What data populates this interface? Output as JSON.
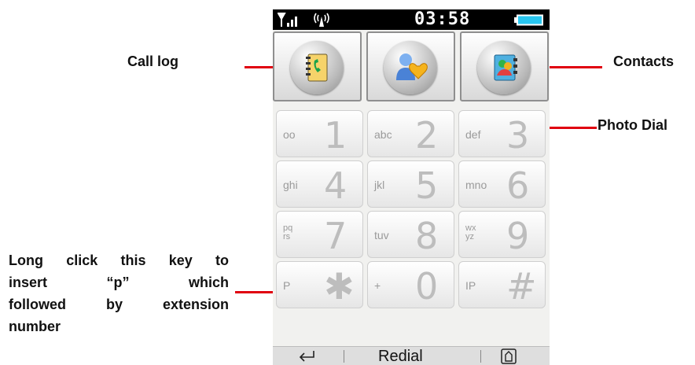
{
  "status": {
    "time": "03:58"
  },
  "top_buttons": [
    {
      "name": "call-log-button",
      "icon": "call-log-icon"
    },
    {
      "name": "photo-dial-button",
      "icon": "photo-dial-icon"
    },
    {
      "name": "contacts-button",
      "icon": "contacts-icon"
    }
  ],
  "keypad": [
    {
      "sub": "oo",
      "digit": "1"
    },
    {
      "sub": "abc",
      "digit": "2"
    },
    {
      "sub": "def",
      "digit": "3"
    },
    {
      "sub": "ghi",
      "digit": "4"
    },
    {
      "sub": "jkl",
      "digit": "5"
    },
    {
      "sub": "mno",
      "digit": "6"
    },
    {
      "sub": "pq rs",
      "digit": "7"
    },
    {
      "sub": "tuv",
      "digit": "8"
    },
    {
      "sub": "wx yz",
      "digit": "9"
    },
    {
      "sub": "P",
      "digit": "✱"
    },
    {
      "sub": "+",
      "digit": "0"
    },
    {
      "sub": "IP",
      "digit": "#"
    }
  ],
  "bottom_bar": {
    "center_label": "Redial"
  },
  "annotations": {
    "call_log": "Call log",
    "contacts": "Contacts",
    "photo_dial": "Photo Dial",
    "long_click": [
      "Long click this key to",
      "insert “p” which",
      "followed by extension",
      "number"
    ]
  },
  "colors": {
    "callout_line": "#e00010",
    "battery": "#28c6f0"
  }
}
